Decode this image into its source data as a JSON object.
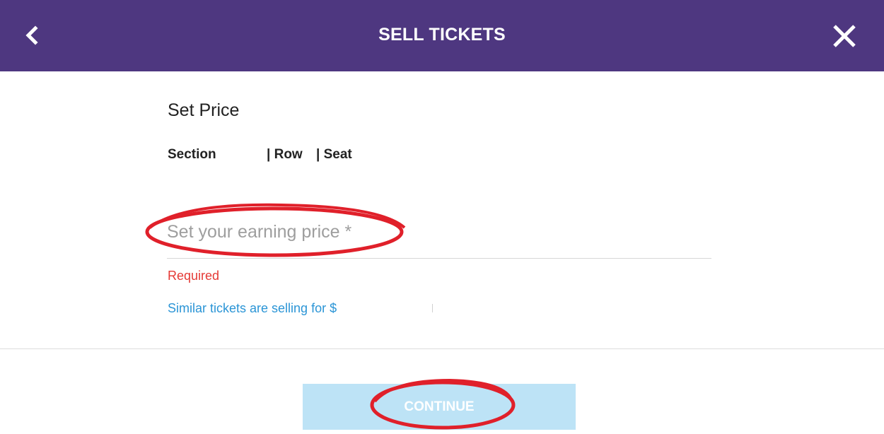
{
  "header": {
    "title": "SELL TICKETS",
    "back_icon": "chevron-left-icon",
    "close_icon": "close-icon",
    "background_color": "#4e3780"
  },
  "main": {
    "heading": "Set Price",
    "details": {
      "section_label": "Section",
      "row_label": "| Row",
      "seat_label": "| Seat"
    },
    "price_input": {
      "placeholder": "Set your earning price *",
      "value": ""
    },
    "validation_message": "Required",
    "similar_price_text": "Similar tickets are selling for $"
  },
  "footer": {
    "continue_label": "CONTINUE",
    "continue_color": "#bde3f6"
  },
  "annotations": {
    "highlight_color": "#e0202a"
  }
}
